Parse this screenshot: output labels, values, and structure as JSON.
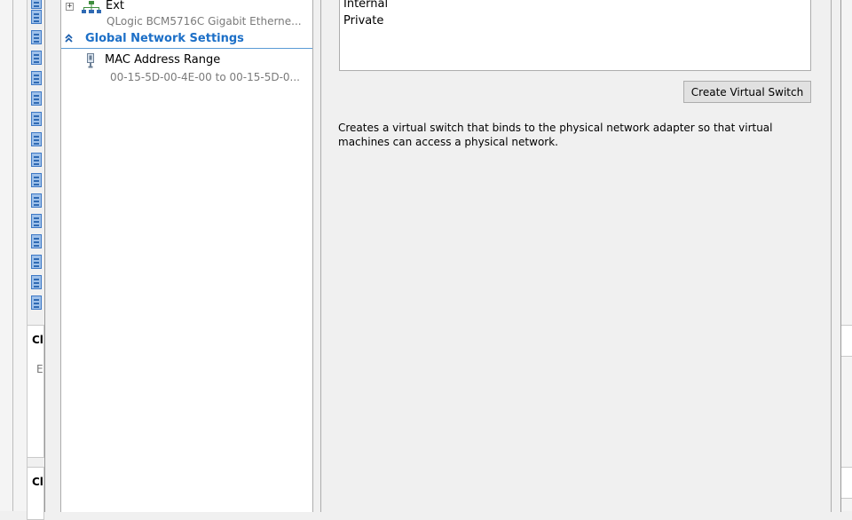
{
  "background": {
    "panel_titles": [
      "Cl",
      "Cl"
    ],
    "panel_sub": "E"
  },
  "tree": {
    "switch": {
      "expander": "+",
      "label": "Ext",
      "adapter": "QLogic BCM5716C Gigabit Etherne..."
    },
    "global_section": {
      "chevron": "»",
      "label": "Global Network Settings"
    },
    "mac": {
      "label": "MAC Address Range",
      "range": "00-15-5D-00-4E-00 to 00-15-5D-0..."
    }
  },
  "switch_types": [
    "Internal",
    "Private"
  ],
  "create_button": "Create Virtual Switch",
  "description": "Creates a virtual switch that binds to the physical network adapter so that virtual machines can access a physical network.",
  "icons": {
    "network": "network-adapter-icon",
    "mac": "mac-range-icon",
    "vm": "virtual-machine-icon"
  },
  "colors": {
    "section_header": "#1c6fc7",
    "section_rule": "#5a9bd6",
    "vm_icon": "#3d78c5"
  }
}
